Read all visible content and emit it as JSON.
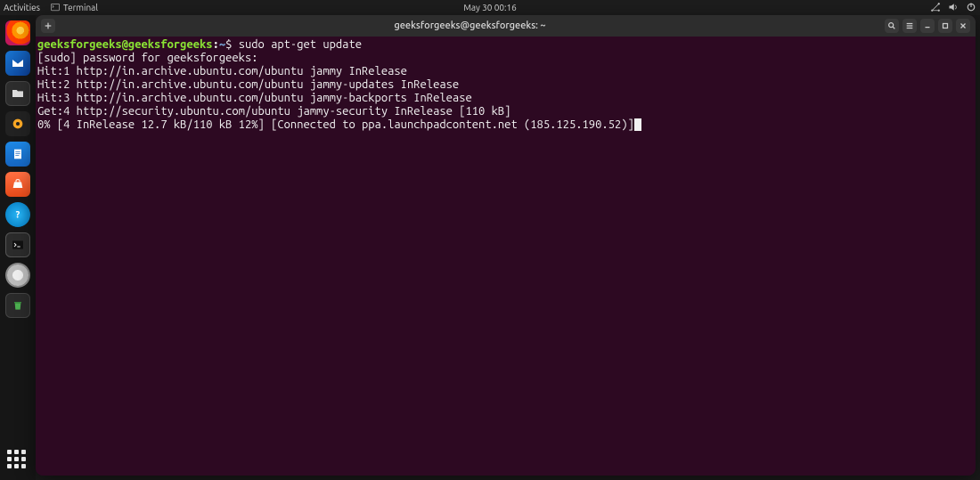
{
  "top_panel": {
    "activities": "Activities",
    "app_indicator": "Terminal",
    "clock": "May 30  00:16"
  },
  "dock": {
    "items": [
      {
        "name": "firefox",
        "label": "Firefox"
      },
      {
        "name": "thunderbird",
        "label": "Thunderbird"
      },
      {
        "name": "files",
        "label": "Files"
      },
      {
        "name": "rhythmbox",
        "label": "Rhythmbox"
      },
      {
        "name": "writer",
        "label": "LibreOffice Writer"
      },
      {
        "name": "software",
        "label": "Ubuntu Software"
      },
      {
        "name": "help",
        "label": "Help"
      },
      {
        "name": "terminal",
        "label": "Terminal"
      },
      {
        "name": "disk",
        "label": "Disk"
      },
      {
        "name": "trash",
        "label": "Trash"
      }
    ]
  },
  "window": {
    "title": "geeksforgeeks@geeksforgeeks: ~"
  },
  "terminal": {
    "prompt": {
      "user_host": "geeksforgeeks@geeksforgeeks",
      "colon": ":",
      "path": "~",
      "dollar": "$"
    },
    "command": "sudo apt-get update",
    "output_lines": [
      "[sudo] password for geeksforgeeks: ",
      "Hit:1 http://in.archive.ubuntu.com/ubuntu jammy InRelease",
      "Hit:2 http://in.archive.ubuntu.com/ubuntu jammy-updates InRelease",
      "Hit:3 http://in.archive.ubuntu.com/ubuntu jammy-backports InRelease",
      "Get:4 http://security.ubuntu.com/ubuntu jammy-security InRelease [110 kB]",
      "0% [4 InRelease 12.7 kB/110 kB 12%] [Connected to ppa.launchpadcontent.net (185.125.190.52)]"
    ]
  }
}
